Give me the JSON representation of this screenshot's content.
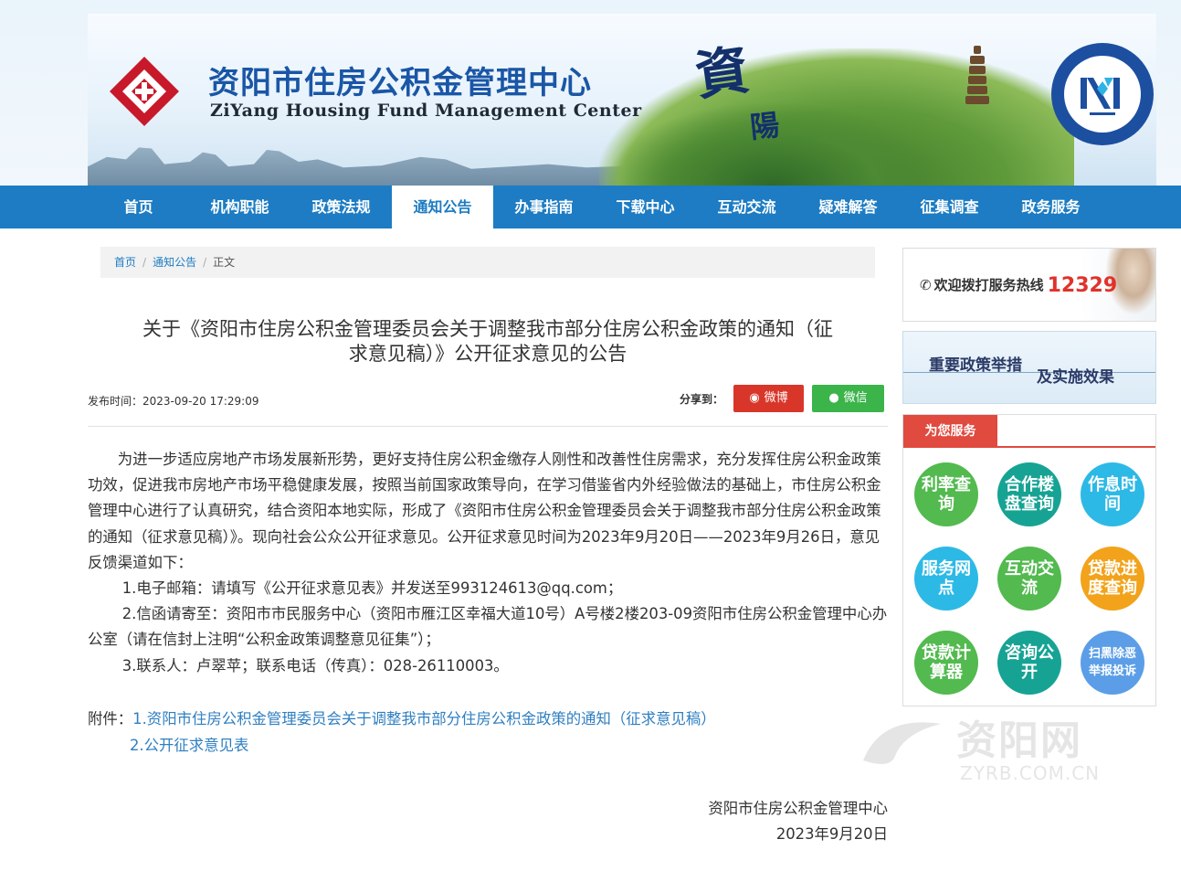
{
  "header": {
    "title": "资阳市住房公积金管理中心",
    "subtitle": "ZiYang Housing Fund Management Center",
    "calligraphy_1": "資",
    "calligraphy_2": "陽",
    "brand_color": "#1d7cc3"
  },
  "nav": {
    "items": [
      "首页",
      "机构职能",
      "政策法规",
      "通知公告",
      "办事指南",
      "下载中心",
      "互动交流",
      "疑难解答",
      "征集调查",
      "政务服务"
    ],
    "active_index": 3
  },
  "breadcrumb": {
    "home": "首页",
    "section": "通知公告",
    "current": "正文",
    "separator": "/"
  },
  "article": {
    "title_line1": "关于《资阳市住房公积金管理委员会关于调整我市部分住房公积金政策的通知（征",
    "title_line2": "求意见稿）》公开征求意见的公告",
    "publish_label": "发布时间：",
    "publish_time": "2023-09-20 17:29:09",
    "share_label": "分享到：",
    "share_weibo": "微博",
    "share_wechat": "微信",
    "paragraph": "为进一步适应房地产市场发展新形势，更好支持住房公积金缴存人刚性和改善性住房需求，充分发挥住房公积金政策功效，促进我市房地产市场平稳健康发展，按照当前国家政策导向，在学习借鉴省内外经验做法的基础上，市住房公积金管理中心进行了认真研究，结合资阳本地实际，形成了《资阳市住房公积金管理委员会关于调整我市部分住房公积金政策的通知（征求意见稿）》。现向社会公众公开征求意见。公开征求意见时间为2023年9月20日——2023年9月26日，意见反馈渠道如下：",
    "item1": "1.电子邮箱：请填写《公开征求意见表》并发送至993124613@qq.com；",
    "item2": "2.信函请寄至：资阳市市民服务中心（资阳市雁江区幸福大道10号）A号楼2楼203-09资阳市住房公积金管理中心办公室（请在信封上注明“公积金政策调整意见征集”）；",
    "item3": "3.联系人：卢翠苹；联系电话（传真）：028-26110003。",
    "attach_label": "附件：",
    "attach1": "1.资阳市住房公积金管理委员会关于调整我市部分住房公积金政策的通知（征求意见稿）",
    "attach2": "2.公开征求意见表",
    "sign_org": "资阳市住房公积金管理中心",
    "sign_date": "2023年9月20日"
  },
  "sidebar": {
    "hotline_text": "欢迎拨打服务热线",
    "hotline_number": "12329",
    "policy_title_1": "重要政策举措",
    "policy_title_2": "及实施效果",
    "service_tab": "为您服务",
    "services": [
      {
        "label": "利率查询",
        "color": "#52ba4e"
      },
      {
        "label": "合作楼盘查询",
        "color": "#16a394"
      },
      {
        "label": "作息时间",
        "color": "#2db9e6"
      },
      {
        "label": "服务网点",
        "color": "#2db9e6"
      },
      {
        "label": "互动交流",
        "color": "#52ba4e"
      },
      {
        "label": "贷款进度查询",
        "color": "#f2a31b"
      },
      {
        "label": "贷款计算器",
        "color": "#52ba4e"
      },
      {
        "label": "咨询公开",
        "color": "#16a394"
      },
      {
        "label": "扫黑除恶举报投诉",
        "color": "#5b9ee7"
      }
    ]
  },
  "watermark": {
    "name": "资阳网",
    "url": "ZYRB.COM.CN"
  }
}
